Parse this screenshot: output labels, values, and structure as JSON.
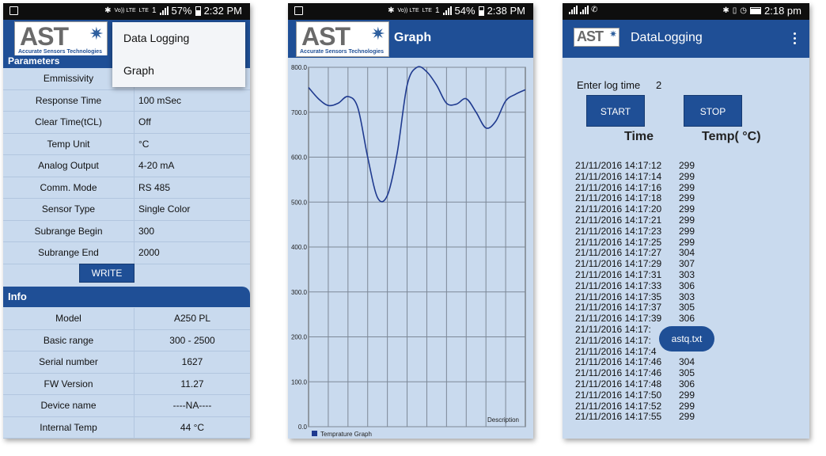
{
  "screen1": {
    "status": {
      "lte": "LTE",
      "volte": "Vo)) LTE",
      "sim": "1",
      "battery": "57%",
      "time": "2:32 PM"
    },
    "logo": {
      "text": "AST",
      "tagline": "Accurate Sensors Technologies"
    },
    "section": "Parameters",
    "menu": [
      "Data Logging",
      "Graph"
    ],
    "params": [
      {
        "label": "Emmissivity",
        "value": ""
      },
      {
        "label": "Response Time",
        "value": "100 mSec"
      },
      {
        "label": "Clear Time(tCL)",
        "value": "Off"
      },
      {
        "label": "Temp Unit",
        "value": "°C"
      },
      {
        "label": "Analog Output",
        "value": "4-20 mA"
      },
      {
        "label": "Comm. Mode",
        "value": "RS 485"
      },
      {
        "label": "Sensor Type",
        "value": "Single Color"
      },
      {
        "label": "Subrange Begin",
        "value": "300"
      },
      {
        "label": "Subrange End",
        "value": "2000"
      }
    ],
    "write_label": "WRITE",
    "info_title": "Info",
    "info": [
      {
        "label": "Model",
        "value": "A250 PL"
      },
      {
        "label": "Basic range",
        "value": "300 - 2500"
      },
      {
        "label": "Serial number",
        "value": "1627"
      },
      {
        "label": "FW Version",
        "value": "11.27"
      },
      {
        "label": "Device name",
        "value": "----NA----"
      },
      {
        "label": "Internal Temp",
        "value": "44 °C"
      }
    ]
  },
  "screen2": {
    "status": {
      "battery": "54%",
      "time": "2:38 PM"
    },
    "title": "Graph",
    "logo": {
      "text": "AST",
      "tagline": "Accurate Sensors Technologies"
    }
  },
  "chart_data": {
    "type": "line",
    "ylim": [
      0,
      800
    ],
    "yticks": [
      "0.0",
      "100.0",
      "200.0",
      "300.0",
      "400.0",
      "500.0",
      "600.0",
      "700.0",
      "800.0"
    ],
    "series": [
      {
        "name": "Temprature Graph",
        "color": "#1f3a8f",
        "values": [
          755,
          730,
          715,
          720,
          735,
          710,
          600,
          510,
          515,
          610,
          760,
          800,
          790,
          760,
          720,
          718,
          730,
          700,
          665,
          680,
          725,
          740,
          750
        ]
      }
    ],
    "description": "Description",
    "grid": true
  },
  "screen3": {
    "status": {
      "time": "2:18 pm"
    },
    "title": "DataLogging",
    "logo": {
      "text": "AST"
    },
    "log_time_label": "Enter log time",
    "log_time_value": "2",
    "start_label": "START",
    "stop_label": "STOP",
    "col_time": "Time",
    "col_temp": "Temp( °C)",
    "toast": "astq.txt",
    "rows": [
      {
        "time": "21/11/2016 14:17:12",
        "temp": "299"
      },
      {
        "time": "21/11/2016 14:17:14",
        "temp": "299"
      },
      {
        "time": "21/11/2016 14:17:16",
        "temp": "299"
      },
      {
        "time": "21/11/2016 14:17:18",
        "temp": "299"
      },
      {
        "time": "21/11/2016 14:17:20",
        "temp": "299"
      },
      {
        "time": "21/11/2016 14:17:21",
        "temp": "299"
      },
      {
        "time": "21/11/2016 14:17:23",
        "temp": "299"
      },
      {
        "time": "21/11/2016 14:17:25",
        "temp": "299"
      },
      {
        "time": "21/11/2016 14:17:27",
        "temp": "304"
      },
      {
        "time": "21/11/2016 14:17:29",
        "temp": "307"
      },
      {
        "time": "21/11/2016 14:17:31",
        "temp": "303"
      },
      {
        "time": "21/11/2016 14:17:33",
        "temp": "306"
      },
      {
        "time": "21/11/2016 14:17:35",
        "temp": "303"
      },
      {
        "time": "21/11/2016 14:17:37",
        "temp": "305"
      },
      {
        "time": "21/11/2016 14:17:39",
        "temp": "306"
      },
      {
        "time": "21/11/2016 14:17:",
        "temp": ""
      },
      {
        "time": "21/11/2016 14:17:",
        "temp": ""
      },
      {
        "time": "21/11/2016 14:17:4",
        "temp": ""
      },
      {
        "time": "21/11/2016 14:17:46",
        "temp": "304"
      },
      {
        "time": "21/11/2016 14:17:46",
        "temp": "305"
      },
      {
        "time": "21/11/2016 14:17:48",
        "temp": "306"
      },
      {
        "time": "21/11/2016 14:17:50",
        "temp": "299"
      },
      {
        "time": "21/11/2016 14:17:52",
        "temp": "299"
      },
      {
        "time": "21/11/2016 14:17:55",
        "temp": "299"
      }
    ]
  }
}
